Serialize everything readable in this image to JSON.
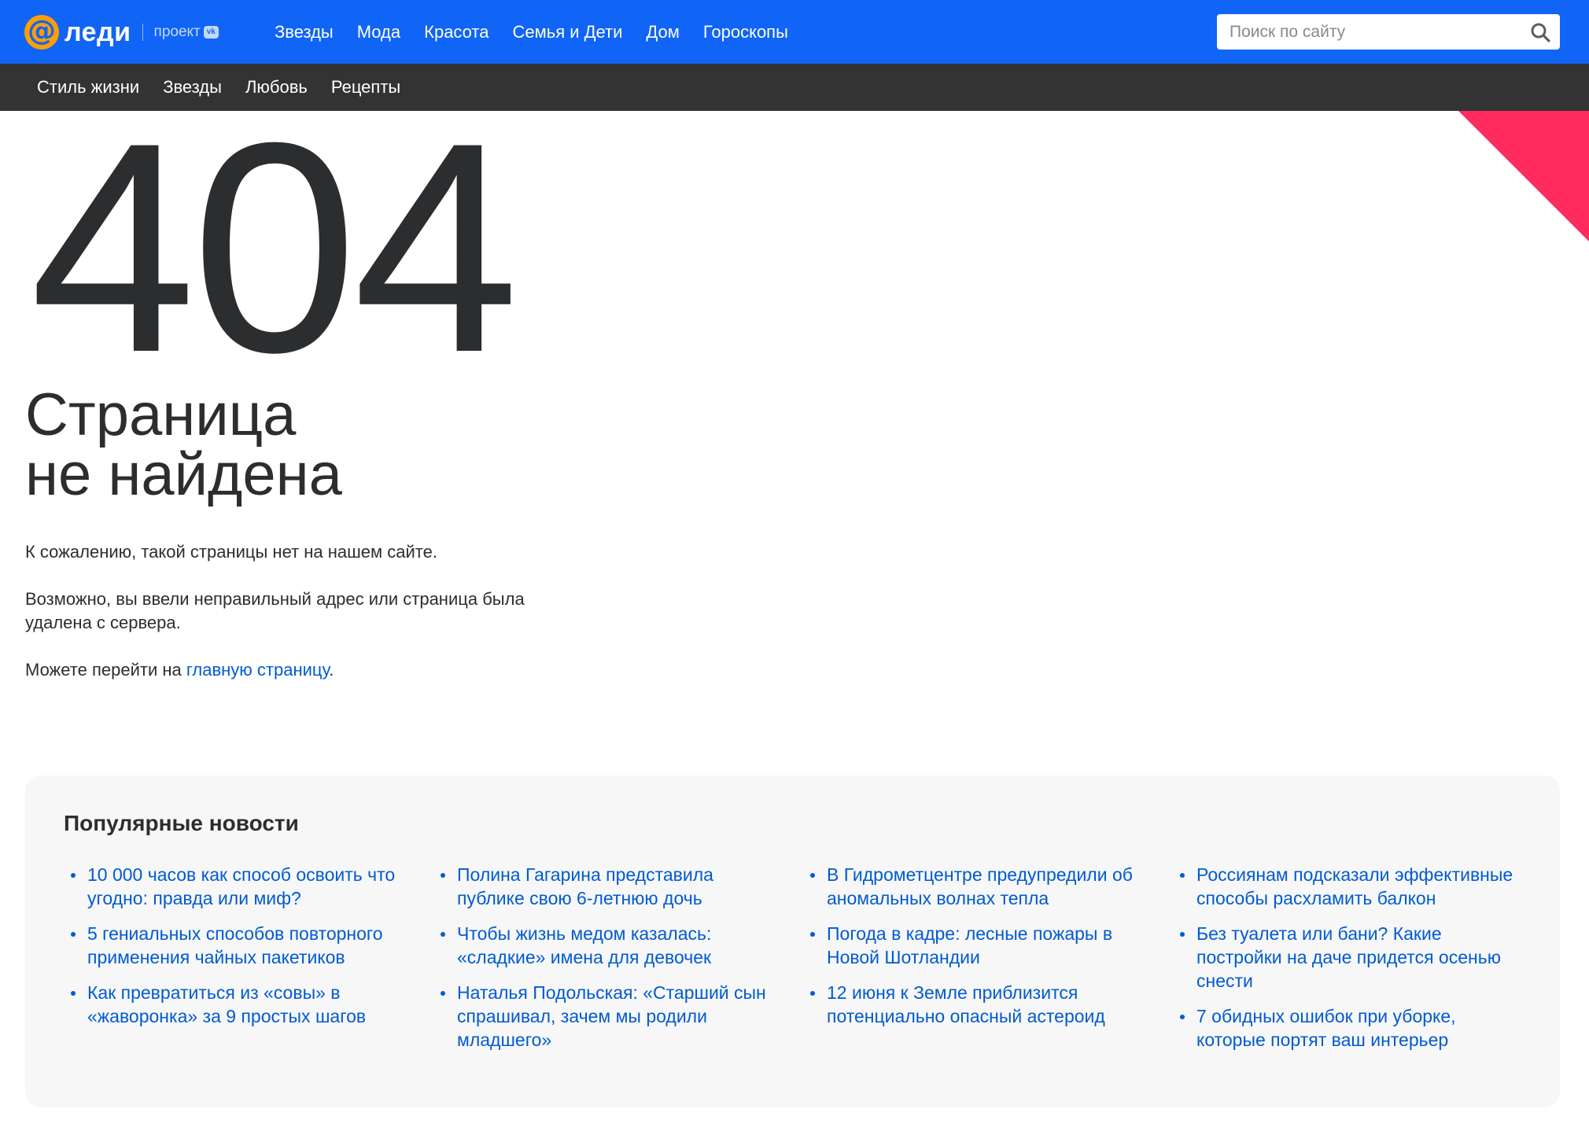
{
  "header": {
    "logo_text": "леди",
    "project_label": "проект",
    "vk_badge": "vk",
    "nav": [
      "Звезды",
      "Мода",
      "Красота",
      "Семья и Дети",
      "Дом",
      "Гороскопы"
    ],
    "search_placeholder": "Поиск по сайту",
    "brand_color": "#1064f6",
    "logo_accent_color": "#ff9e00"
  },
  "subnav": {
    "items": [
      "Стиль жизни",
      "Звезды",
      "Любовь",
      "Рецепты"
    ],
    "bg_color": "#333333"
  },
  "error": {
    "code": "404",
    "title_line1": "Страница",
    "title_line2": "не найдена",
    "para1": "К сожалению, такой страницы нет на нашем сайте.",
    "para2_line1": "Возможно, вы ввели неправильный адрес или страница была",
    "para2_line2": "удалена с сервера.",
    "para3_prefix": "Можете перейти на ",
    "para3_link": "главную страницу",
    "para3_suffix": "."
  },
  "popular": {
    "heading": "Популярные новости",
    "columns": [
      [
        "10 000 часов как способ освоить что угодно: правда или миф?",
        "5 гениальных способов повторного применения чайных пакетиков",
        "Как превратиться из «совы» в «жаворонка» за 9 простых шагов"
      ],
      [
        "Полина Гагарина представила публике свою 6-летнюю дочь",
        "Чтобы жизнь медом казалась: «сладкие» имена для девочек",
        "Наталья Подольская: «Старший сын спрашивал, зачем мы родили младшего»"
      ],
      [
        "В Гидрометцентре предупредили об аномальных волнах тепла",
        "Погода в кадре: лесные пожары в Новой Шотландии",
        "12 июня к Земле приблизится потенциально опасный астероид"
      ],
      [
        "Россиянам подсказали эффективные способы расхламить балкон",
        "Без туалета или бани? Какие постройки на даче придется осенью снести",
        "7 обидных ошибок при уборке, которые портят ваш интерьер"
      ]
    ],
    "link_color": "#005bd1"
  },
  "decor": {
    "corner_color": "#ff2b5e"
  }
}
